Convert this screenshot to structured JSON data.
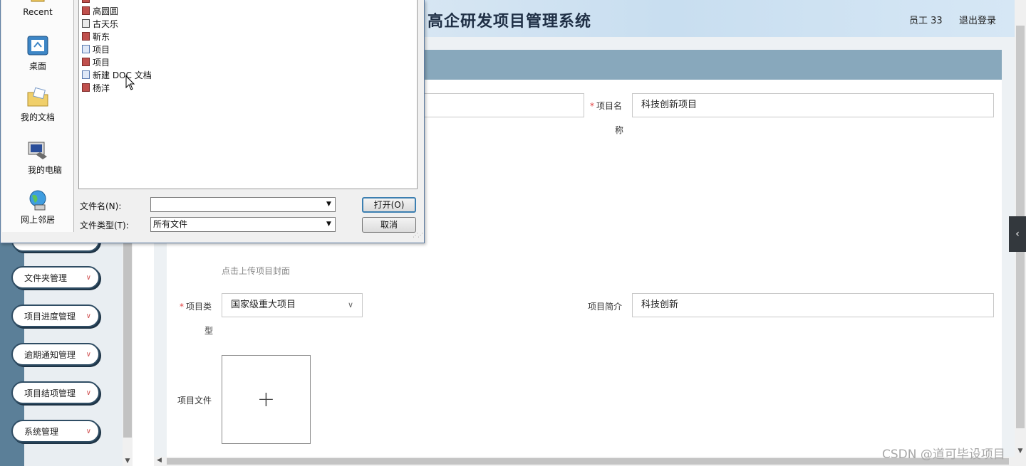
{
  "header": {
    "title": "高企研发项目管理系统",
    "user": "员工 33",
    "logout": "退出登录"
  },
  "sidebar": {
    "items": [
      {
        "label": "文件夹管理"
      },
      {
        "label": "项目进度管理"
      },
      {
        "label": "逾期通知管理"
      },
      {
        "label": "项目结项管理"
      },
      {
        "label": "系统管理"
      }
    ]
  },
  "form": {
    "project_name_label_line1": "项目名",
    "project_name_label_line2": "称",
    "project_name_value": "科技创新项目",
    "cover_hint": "点击上传项目封面",
    "project_type_label_line1": "项目类",
    "project_type_label_line2": "型",
    "project_type_value": "国家级重大项目",
    "project_intro_label": "项目简介",
    "project_intro_value": "科技创新",
    "project_file_label": "项目文件",
    "upload_plus": "+"
  },
  "dialog": {
    "places": [
      {
        "label": "Recent"
      },
      {
        "label": "桌面"
      },
      {
        "label": "我的文档"
      },
      {
        "label": "我的电脑"
      },
      {
        "label": "网上邻居"
      }
    ],
    "files": [
      {
        "name": "高圆圆",
        "type": "ppt"
      },
      {
        "name": "古天乐",
        "type": "xls"
      },
      {
        "name": "靳东",
        "type": "ppt"
      },
      {
        "name": "项目",
        "type": "doc"
      },
      {
        "name": "项目",
        "type": "ppt"
      },
      {
        "name": "新建 DOC 文档",
        "type": "doc"
      },
      {
        "name": "杨洋",
        "type": "ppt"
      }
    ],
    "filename_label": "文件名(N):",
    "filename_value": "",
    "filetype_label": "文件类型(T):",
    "filetype_value": "所有文件",
    "open_button": "打开(O)",
    "cancel_button": "取消"
  },
  "watermark": "CSDN @道可毕设项目",
  "colors": {
    "sidebar_strip": "#5b7f98",
    "section_bar": "#88a8bc",
    "required_star": "#e04040",
    "menu_border": "#2f4d64"
  }
}
